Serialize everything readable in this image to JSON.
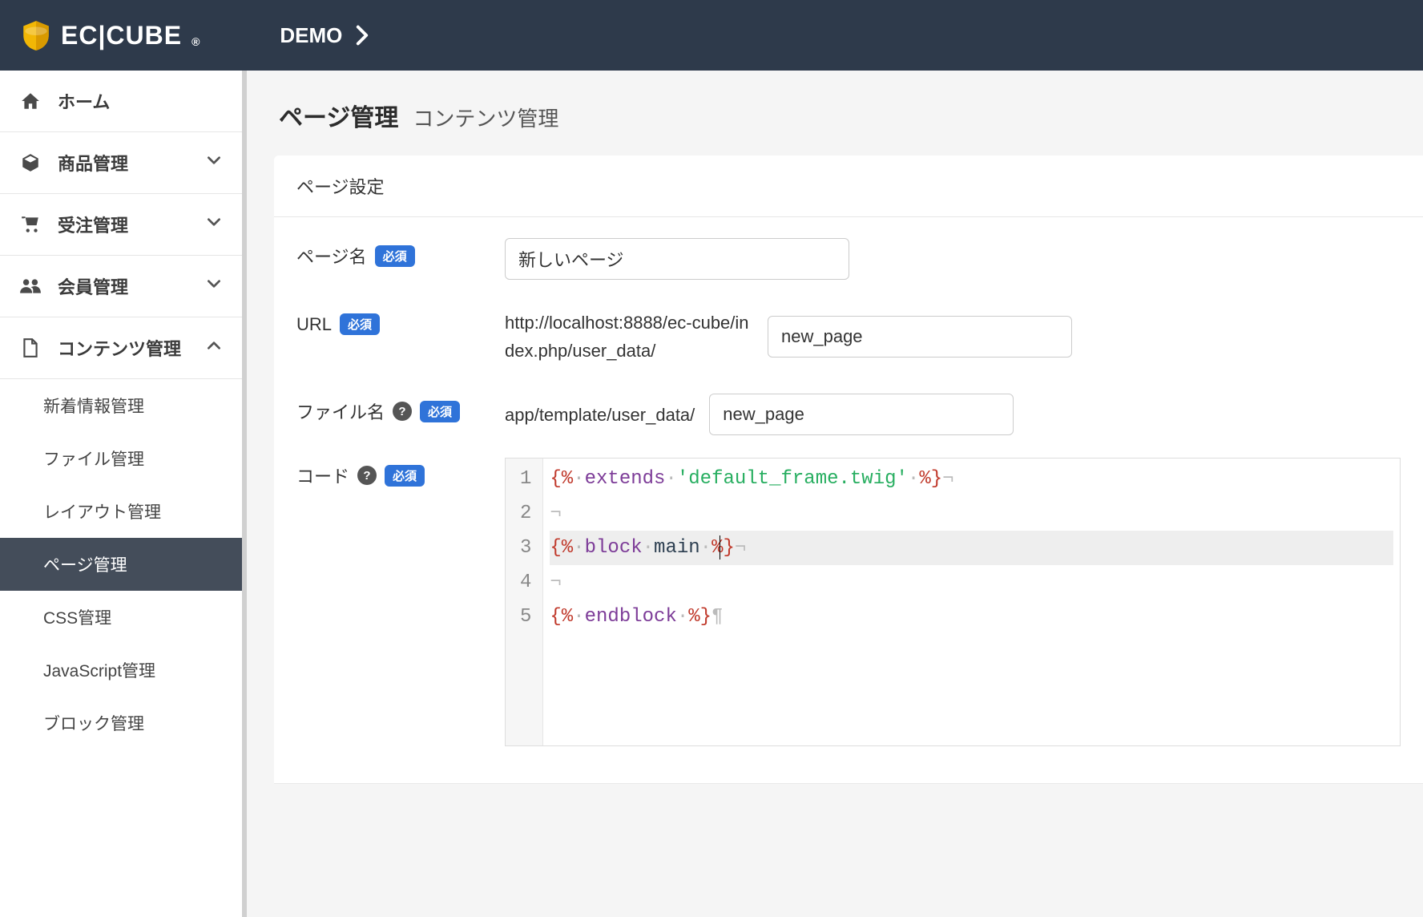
{
  "header": {
    "logo_text": "EC|CUBE",
    "demo_label": "DEMO"
  },
  "sidebar": {
    "items": [
      {
        "label": "ホーム",
        "icon": "home",
        "expandable": false
      },
      {
        "label": "商品管理",
        "icon": "cube",
        "expandable": true,
        "expanded": false
      },
      {
        "label": "受注管理",
        "icon": "cart",
        "expandable": true,
        "expanded": false
      },
      {
        "label": "会員管理",
        "icon": "users",
        "expandable": true,
        "expanded": false
      },
      {
        "label": "コンテンツ管理",
        "icon": "file",
        "expandable": true,
        "expanded": true
      }
    ],
    "content_sub": [
      {
        "label": "新着情報管理",
        "active": false
      },
      {
        "label": "ファイル管理",
        "active": false
      },
      {
        "label": "レイアウト管理",
        "active": false
      },
      {
        "label": "ページ管理",
        "active": true
      },
      {
        "label": "CSS管理",
        "active": false
      },
      {
        "label": "JavaScript管理",
        "active": false
      },
      {
        "label": "ブロック管理",
        "active": false
      }
    ]
  },
  "page": {
    "title": "ページ管理",
    "subtitle": "コンテンツ管理"
  },
  "card": {
    "header": "ページ設定",
    "required_label": "必須",
    "rows": {
      "name": {
        "label": "ページ名",
        "value": "新しいページ"
      },
      "url": {
        "label": "URL",
        "prefix": "http://localhost:8888/ec-cube/index.php/user_data/",
        "value": "new_page"
      },
      "filename": {
        "label": "ファイル名",
        "prefix": "app/template/user_data/",
        "value": "new_page"
      },
      "code": {
        "label": "コード"
      }
    }
  },
  "editor": {
    "lines": [
      {
        "n": 1,
        "tokens": [
          {
            "t": "{%",
            "c": "delim"
          },
          {
            "t": "·",
            "c": "ws"
          },
          {
            "t": "extends",
            "c": "kw"
          },
          {
            "t": "·",
            "c": "ws"
          },
          {
            "t": "'default_frame.twig'",
            "c": "str"
          },
          {
            "t": "·",
            "c": "ws"
          },
          {
            "t": "%}",
            "c": "delim"
          },
          {
            "t": "¬",
            "c": "ws"
          }
        ]
      },
      {
        "n": 2,
        "tokens": [
          {
            "t": "¬",
            "c": "ws"
          }
        ]
      },
      {
        "n": 3,
        "highlight": true,
        "tokens": [
          {
            "t": "{%",
            "c": "delim"
          },
          {
            "t": "·",
            "c": "ws"
          },
          {
            "t": "block",
            "c": "kw"
          },
          {
            "t": "·",
            "c": "ws"
          },
          {
            "t": "main",
            "c": "ident"
          },
          {
            "t": "·",
            "c": "ws"
          },
          {
            "t": "%}",
            "c": "delim"
          },
          {
            "t": "¬",
            "c": "ws"
          }
        ]
      },
      {
        "n": 4,
        "tokens": [
          {
            "t": "¬",
            "c": "ws"
          }
        ]
      },
      {
        "n": 5,
        "tokens": [
          {
            "t": "{%",
            "c": "delim"
          },
          {
            "t": "·",
            "c": "ws"
          },
          {
            "t": "endblock",
            "c": "kw"
          },
          {
            "t": "·",
            "c": "ws"
          },
          {
            "t": "%}",
            "c": "delim"
          },
          {
            "t": "¶",
            "c": "ws"
          }
        ]
      }
    ]
  }
}
